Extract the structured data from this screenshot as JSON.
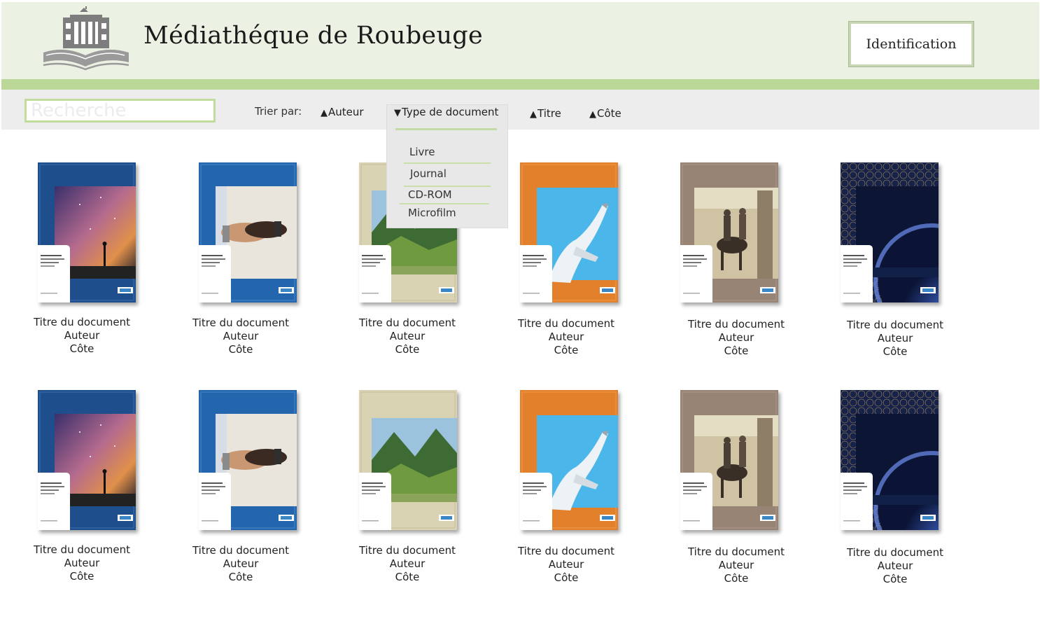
{
  "header": {
    "title": "Médiathéque de Roubeuge",
    "login_button": "Identification",
    "logo_icon": "library-book-logo-icon"
  },
  "toolbar": {
    "search_placeholder": "Recherche",
    "sort_label": "Trier par:",
    "sort_options": [
      {
        "label": "Auteur",
        "direction": "up"
      },
      {
        "label": "Type de document",
        "direction": "down"
      },
      {
        "label": "Titre",
        "direction": "up"
      },
      {
        "label": "Côte",
        "direction": "up"
      }
    ],
    "arrow_up": "▲",
    "arrow_down": "▼"
  },
  "dropdown": {
    "items": [
      "Livre",
      "Journal",
      "CD-ROM",
      "Microfilm"
    ]
  },
  "documents": [
    {
      "title": "Titre du document",
      "author": "Auteur",
      "shelf": "Côte",
      "cover_theme": "blue-starry-sky"
    },
    {
      "title": "Titre du document",
      "author": "Auteur",
      "shelf": "Côte",
      "cover_theme": "blue-handshake"
    },
    {
      "title": "Titre du document",
      "author": "Auteur",
      "shelf": "Côte",
      "cover_theme": "beige-mountains"
    },
    {
      "title": "Titre du document",
      "author": "Auteur",
      "shelf": "Côte",
      "cover_theme": "orange-concorde"
    },
    {
      "title": "Titre du document",
      "author": "Auteur",
      "shelf": "Côte",
      "cover_theme": "taupe-horse-carriage"
    },
    {
      "title": "Titre du document",
      "author": "Auteur",
      "shelf": "Côte",
      "cover_theme": "navy-planet"
    },
    {
      "title": "Titre du document",
      "author": "Auteur",
      "shelf": "Côte",
      "cover_theme": "blue-starry-sky"
    },
    {
      "title": "Titre du document",
      "author": "Auteur",
      "shelf": "Côte",
      "cover_theme": "blue-handshake"
    },
    {
      "title": "Titre du document",
      "author": "Auteur",
      "shelf": "Côte",
      "cover_theme": "beige-mountains"
    },
    {
      "title": "Titre du document",
      "author": "Auteur",
      "shelf": "Côte",
      "cover_theme": "orange-concorde"
    },
    {
      "title": "Titre du document",
      "author": "Auteur",
      "shelf": "Côte",
      "cover_theme": "taupe-horse-carriage"
    },
    {
      "title": "Titre du document",
      "author": "Auteur",
      "shelf": "Côte",
      "cover_theme": "navy-planet"
    }
  ],
  "colors": {
    "header_bg": "#ebf1e3",
    "accent_green": "#bcd898",
    "toolbar_bg": "#ededed"
  }
}
